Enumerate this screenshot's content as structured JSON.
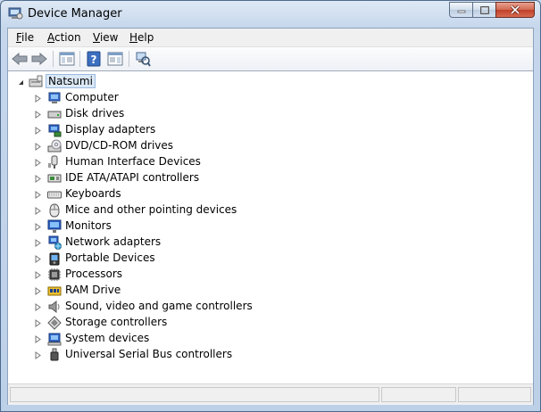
{
  "window": {
    "title": "Device Manager"
  },
  "menu": [
    {
      "label": "File",
      "accel": "F",
      "rest": "ile"
    },
    {
      "label": "Action",
      "accel": "A",
      "rest": "ction"
    },
    {
      "label": "View",
      "accel": "V",
      "rest": "iew"
    },
    {
      "label": "Help",
      "accel": "H",
      "rest": "elp"
    }
  ],
  "toolbar": [
    "back-icon",
    "forward-icon",
    "properties-view-icon",
    "help-icon",
    "action-pane-icon",
    "scan-hardware-icon"
  ],
  "tree": {
    "root": "Natsumi",
    "categories": [
      {
        "label": "Computer",
        "icon": "computer-icon"
      },
      {
        "label": "Disk drives",
        "icon": "disk-drive-icon"
      },
      {
        "label": "Display adapters",
        "icon": "display-adapter-icon"
      },
      {
        "label": "DVD/CD-ROM drives",
        "icon": "dvd-drive-icon"
      },
      {
        "label": "Human Interface Devices",
        "icon": "hid-icon"
      },
      {
        "label": "IDE ATA/ATAPI controllers",
        "icon": "ide-controller-icon"
      },
      {
        "label": "Keyboards",
        "icon": "keyboard-icon"
      },
      {
        "label": "Mice and other pointing devices",
        "icon": "mouse-icon"
      },
      {
        "label": "Monitors",
        "icon": "monitor-icon"
      },
      {
        "label": "Network adapters",
        "icon": "network-adapter-icon"
      },
      {
        "label": "Portable Devices",
        "icon": "portable-device-icon"
      },
      {
        "label": "Processors",
        "icon": "processor-icon"
      },
      {
        "label": "RAM Drive",
        "icon": "ram-drive-icon"
      },
      {
        "label": "Sound, video and game controllers",
        "icon": "sound-icon"
      },
      {
        "label": "Storage controllers",
        "icon": "storage-controller-icon"
      },
      {
        "label": "System devices",
        "icon": "system-device-icon"
      },
      {
        "label": "Universal Serial Bus controllers",
        "icon": "usb-icon"
      }
    ]
  }
}
